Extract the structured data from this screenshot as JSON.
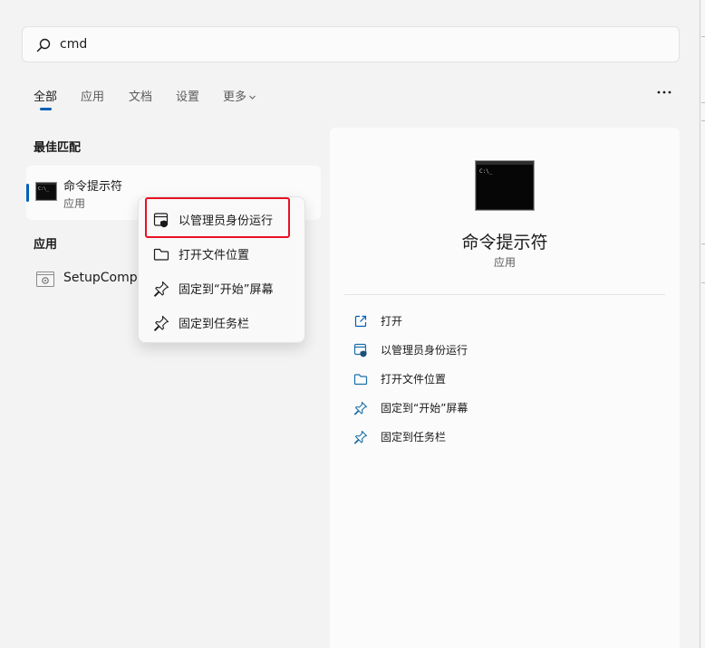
{
  "colors": {
    "accent": "#005fb8",
    "highlight": "#e81123",
    "text_primary": "#1b1b1b",
    "text_secondary": "#5c5c5c"
  },
  "search": {
    "value": "cmd",
    "icon": "search-icon"
  },
  "tabs": [
    {
      "label": "全部",
      "active": true
    },
    {
      "label": "应用",
      "active": false
    },
    {
      "label": "文档",
      "active": false
    },
    {
      "label": "设置",
      "active": false
    },
    {
      "label": "更多",
      "active": false
    }
  ],
  "more_options_icon": "more-options-icon",
  "best_match": {
    "section_title": "最佳匹配",
    "name": "命令提示符",
    "type": "应用",
    "icon": "command-prompt-icon"
  },
  "apps": {
    "section_title": "应用",
    "items": [
      {
        "label": "SetupCompl",
        "icon": "setup-app-icon"
      }
    ]
  },
  "context_menu": {
    "items": [
      {
        "label": "以管理员身份运行",
        "icon": "admin-shield-icon",
        "highlighted": true
      },
      {
        "label": "打开文件位置",
        "icon": "folder-icon"
      },
      {
        "label": "固定到“开始”屏幕",
        "icon": "pin-icon"
      },
      {
        "label": "固定到任务栏",
        "icon": "pin-icon"
      }
    ]
  },
  "preview": {
    "name": "命令提示符",
    "type": "应用",
    "icon": "command-prompt-icon",
    "actions": [
      {
        "label": "打开",
        "icon": "open-external-icon"
      },
      {
        "label": "以管理员身份运行",
        "icon": "admin-shield-icon"
      },
      {
        "label": "打开文件位置",
        "icon": "folder-icon"
      },
      {
        "label": "固定到“开始”屏幕",
        "icon": "pin-icon"
      },
      {
        "label": "固定到任务栏",
        "icon": "pin-icon"
      }
    ]
  }
}
